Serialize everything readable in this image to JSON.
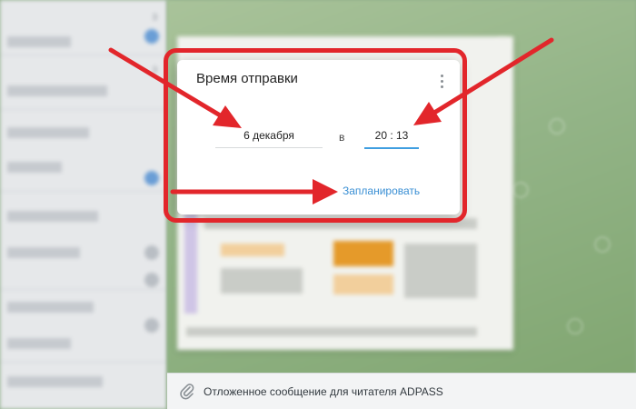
{
  "dialog": {
    "title": "Время отправки",
    "date_value": "6 декабря",
    "connector": "в",
    "time_value": "20 : 13",
    "schedule_label": "Запланировать"
  },
  "compose": {
    "text": "Отложенное сообщение для читателя ADPASS"
  },
  "sidebar": {
    "badge_digits": [
      "3",
      "3"
    ]
  },
  "colors": {
    "annotation_red": "#e2262b",
    "accent_blue": "#3a8fd4",
    "input_underline_active": "#3f9ee0"
  },
  "icons": {
    "menu": "kebab-menu-icon",
    "attach": "paperclip-icon"
  }
}
